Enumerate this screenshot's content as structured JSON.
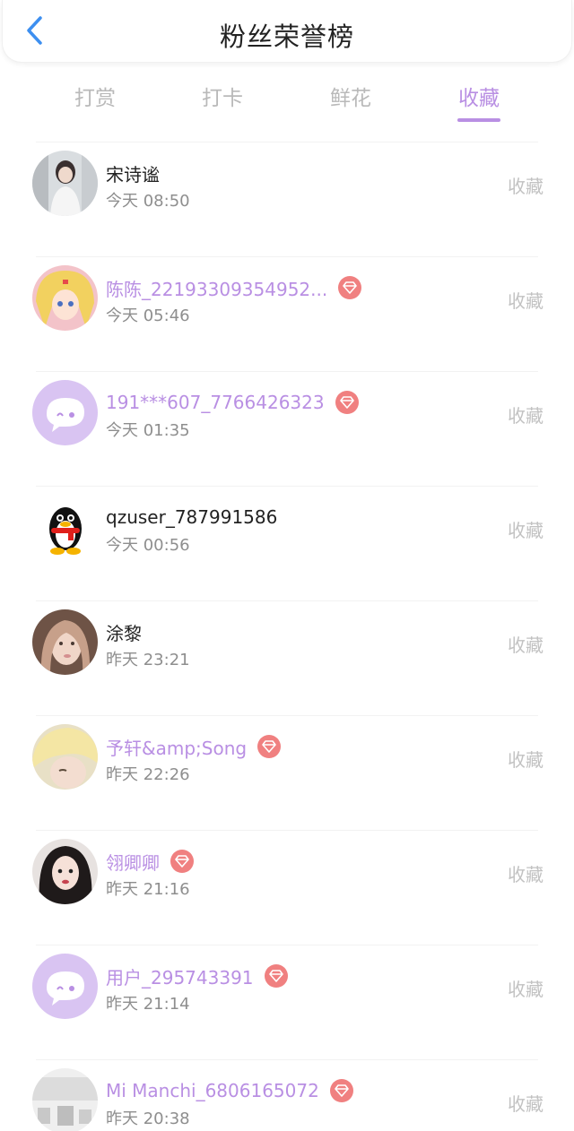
{
  "header": {
    "title": "粉丝荣誉榜"
  },
  "tabs": [
    {
      "label": "打赏"
    },
    {
      "label": "打卡"
    },
    {
      "label": "鲜花"
    },
    {
      "label": "收藏"
    }
  ],
  "active_tab": "收藏",
  "colors": {
    "accent": "#b98fe3",
    "vip_badge": "#f08080",
    "back": "#3d8ff0"
  },
  "fans": [
    {
      "name": "宋诗谧",
      "time": "今天 08:50",
      "vip": false,
      "action": "收藏"
    },
    {
      "name": "陈陈_22193309354952...",
      "time": "今天 05:46",
      "vip": true,
      "action": "收藏"
    },
    {
      "name": "191***607_7766426323",
      "time": "今天 01:35",
      "vip": true,
      "action": "收藏"
    },
    {
      "name": "qzuser_787991586",
      "time": "今天 00:56",
      "vip": false,
      "action": "收藏"
    },
    {
      "name": "涂黎",
      "time": "昨天 23:21",
      "vip": false,
      "action": "收藏"
    },
    {
      "name": "予轩&amp;Song",
      "time": "昨天 22:26",
      "vip": true,
      "action": "收藏"
    },
    {
      "name": "翎卿卿",
      "time": "昨天 21:16",
      "vip": true,
      "action": "收藏"
    },
    {
      "name": "用户_295743391",
      "time": "昨天 21:14",
      "vip": true,
      "action": "收藏"
    },
    {
      "name": "Mi Manchi_6806165072",
      "time": "昨天 20:38",
      "vip": true,
      "action": "收藏"
    }
  ]
}
